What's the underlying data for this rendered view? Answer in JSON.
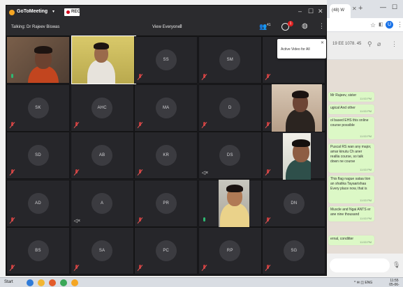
{
  "colors": {
    "window_bg": "#1c1c1f",
    "tile_bg": "#26262a",
    "avatar_bg": "#3b3b40",
    "mic_muted": "#c43b3b",
    "mic_active": "#2eb872",
    "record_red": "#d0021b",
    "whatsapp_bubble": "#dcf8c6",
    "whatsapp_chat_bg": "#e5ddd5"
  },
  "meeting": {
    "app_title": "GoToMeeting",
    "record_label": "REC",
    "talking_label": "Talking: Dr Rajeev Biswas",
    "view_label": "View Everyone",
    "participants_count": "41",
    "chat_unread": "1",
    "popup_text": "Active Video for All"
  },
  "tiles": [
    {
      "name": "tile-video-woman",
      "initials": "",
      "mic": "active",
      "video": true
    },
    {
      "name": "tile-video-man-desk",
      "initials": "",
      "mic": "active",
      "video": true
    },
    {
      "name": "tile-ss",
      "initials": "SS",
      "mic": "muted"
    },
    {
      "name": "tile-sm",
      "initials": "SM",
      "mic": "muted"
    },
    {
      "name": "tile-r5c1",
      "initials": "",
      "mic": "muted"
    },
    {
      "name": "tile-sk",
      "initials": "SK",
      "mic": "muted"
    },
    {
      "name": "tile-ahc",
      "initials": "AHC",
      "mic": "muted"
    },
    {
      "name": "tile-ma",
      "initials": "MA",
      "mic": "muted"
    },
    {
      "name": "tile-d",
      "initials": "D",
      "mic": "muted"
    },
    {
      "name": "tile-video-man-right",
      "initials": "",
      "mic": "muted",
      "video": true
    },
    {
      "name": "tile-sd",
      "initials": "SD",
      "mic": "muted"
    },
    {
      "name": "tile-ab",
      "initials": "AB",
      "mic": "muted"
    },
    {
      "name": "tile-kr",
      "initials": "KR",
      "mic": "muted"
    },
    {
      "name": "tile-ds",
      "initials": "DS",
      "mic": "speaker"
    },
    {
      "name": "tile-video-man-glasses",
      "initials": "",
      "mic": "muted",
      "video": true
    },
    {
      "name": "tile-ad",
      "initials": "AD",
      "mic": "muted"
    },
    {
      "name": "tile-a",
      "initials": "A",
      "mic": "speaker"
    },
    {
      "name": "tile-pr",
      "initials": "PR",
      "mic": "muted"
    },
    {
      "name": "tile-video-young-man",
      "initials": "",
      "mic": "active",
      "video": true
    },
    {
      "name": "tile-dn",
      "initials": "DN",
      "mic": "muted"
    },
    {
      "name": "tile-bs",
      "initials": "BS",
      "mic": "muted"
    },
    {
      "name": "tile-sa",
      "initials": "SA",
      "mic": "muted"
    },
    {
      "name": "tile-pc",
      "initials": "PC",
      "mic": "muted"
    },
    {
      "name": "tile-rp",
      "initials": "RP",
      "mic": "muted"
    },
    {
      "name": "tile-sg",
      "initials": "SG",
      "mic": "muted"
    }
  ],
  "browser": {
    "tab_label": "(48) W",
    "new_tab": "+",
    "minimize": "—",
    "maximize": "☐",
    "avatar_initial": "U",
    "header_text": "19 EE 1078. 45"
  },
  "whatsapp": {
    "messages": [
      {
        "text": "Mr Rajeev, sister",
        "time": "11:53 PM"
      },
      {
        "text": "ugical And other",
        "time": "11:53 PM"
      },
      {
        "text": "ol based EHS this online course possible",
        "time": "11:53 PM"
      },
      {
        "text": "Puscal RS wan any major, amar kinutu Ch aner reallia course, so talk down ne course",
        "time": "11:53 PM"
      },
      {
        "text": "This flag nague sataa tion an shatika Tayaarishaa Every place now, that is",
        "time": "11:53 PM"
      },
      {
        "text": "Muscle and Ngai ANTS er ane nine thousand",
        "time": "11:53 PM"
      },
      {
        "text": "ernal, conditter",
        "time": "11:53 PM"
      }
    ]
  },
  "taskbar": {
    "start_label": "Start",
    "tray_text": "^ ✉ ◫ ENG",
    "time": "11:55",
    "date": "05-06-2020"
  }
}
